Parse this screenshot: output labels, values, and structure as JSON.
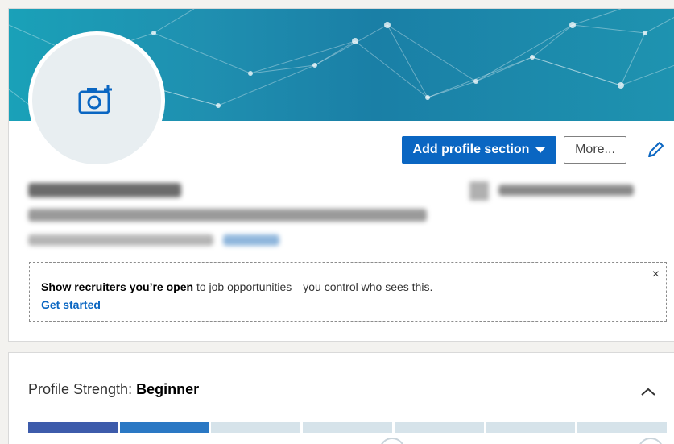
{
  "profile": {
    "add_section_label": "Add profile section",
    "more_label": "More..."
  },
  "open_to_work": {
    "bold_text": "Show recruiters you’re open",
    "rest_text": " to job opportunities—you control who sees this.",
    "link_label": "Get started",
    "close_label": "×"
  },
  "strength": {
    "label": "Profile Strength: ",
    "level": "Beginner",
    "progress_fraction": 0.28
  },
  "icons": {
    "camera": "camera-add-icon",
    "edit": "pencil-icon",
    "chevron": "chevron-up-icon",
    "lock": "lock-icon",
    "star": "star-icon"
  },
  "colors": {
    "accent": "#0a66c2",
    "meter_fill_1": "#3d5bab",
    "meter_fill_2": "#2a78c4",
    "meter_empty": "#d6e3ea"
  }
}
